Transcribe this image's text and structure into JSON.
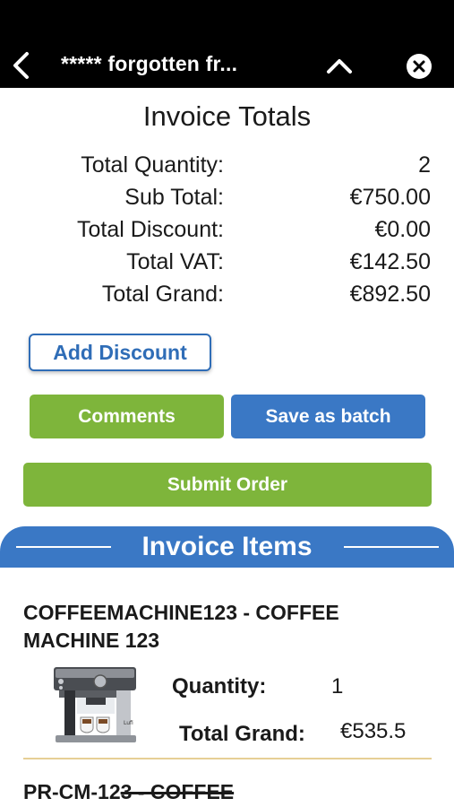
{
  "topbar": {
    "title": "***** forgotten fr...",
    "back_icon": "chevron-left-icon",
    "collapse_icon": "chevron-up-icon",
    "close_icon": "close-circle-icon"
  },
  "totals": {
    "heading": "Invoice Totals",
    "rows": [
      {
        "label": "Total Quantity:",
        "value": "2"
      },
      {
        "label": "Sub Total:",
        "value": "€750.00"
      },
      {
        "label": "Total Discount:",
        "value": "€0.00"
      },
      {
        "label": "Total VAT:",
        "value": "€142.50"
      },
      {
        "label": "Total Grand:",
        "value": "€892.50"
      }
    ]
  },
  "actions": {
    "add_discount": "Add Discount",
    "comments": "Comments",
    "save_batch": "Save as batch",
    "submit_order": "Submit Order"
  },
  "items_section": {
    "title": "Invoice Items",
    "items": [
      {
        "title": "COFFEEMACHINE123 - COFFEE MACHINE 123",
        "image_icon": "coffee-machine-image",
        "quantity_label": "Quantity:",
        "quantity_value": "1",
        "total_label": "Total Grand:",
        "total_value": "€535.5"
      },
      {
        "title_start": "PR-CM-12",
        "title_struck": "3 - COFFEE"
      }
    ]
  },
  "colors": {
    "green": "#7eb53b",
    "blue": "#3a78c5",
    "divider": "#e6cf95"
  }
}
